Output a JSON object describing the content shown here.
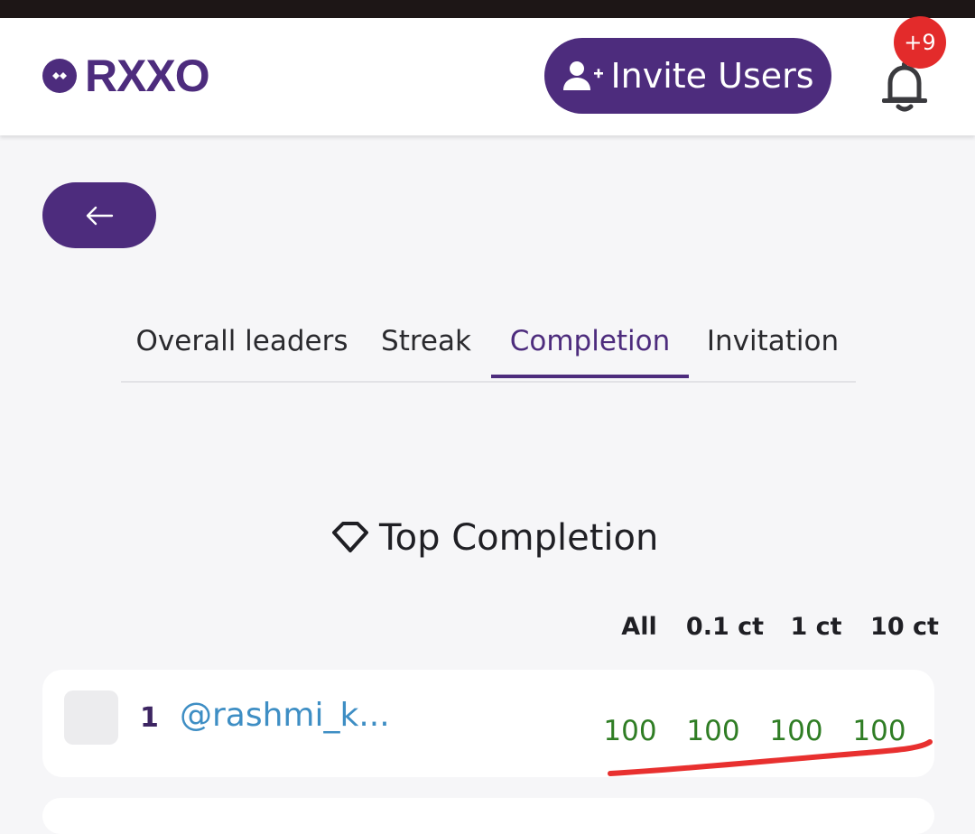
{
  "header": {
    "logo_text": "RXXO",
    "invite_label": "Invite Users",
    "notification_badge": "+9",
    "brand_color": "#4d2c7d",
    "badge_color": "#e32b2b"
  },
  "nav": {
    "back_icon": "arrow-left-icon",
    "back_glyph": "←"
  },
  "tabs": [
    {
      "label": "Overall leaders",
      "active": false
    },
    {
      "label": "Streak",
      "active": false
    },
    {
      "label": "Completion",
      "active": true
    },
    {
      "label": "Invitation",
      "active": false
    }
  ],
  "section": {
    "title": "Top Completion",
    "icon": "diamond-icon"
  },
  "columns": [
    "All",
    "0.1 ct",
    "1 ct",
    "10 ct"
  ],
  "rows": [
    {
      "rank": "1",
      "username": "@rashmi_k...",
      "scores": [
        "100",
        "100",
        "100",
        "100"
      ],
      "score_color": "#2f7d24"
    }
  ],
  "annotation": {
    "color": "#e8302f"
  }
}
